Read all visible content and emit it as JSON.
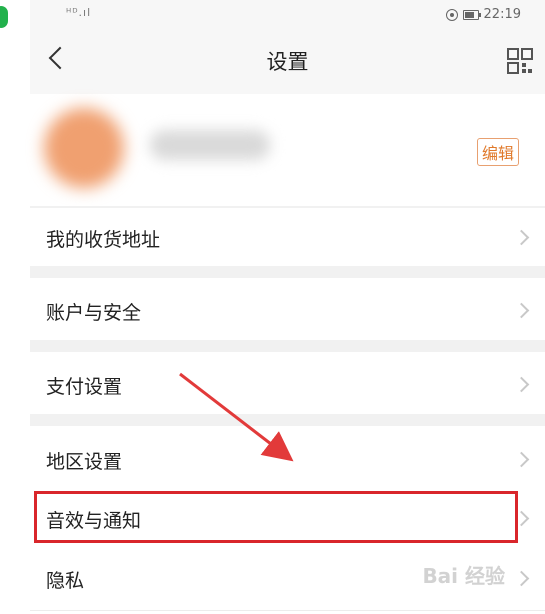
{
  "statusbar": {
    "signal": "ᴴᴰ.ıl",
    "time": "22:19"
  },
  "header": {
    "title": "设置"
  },
  "profile": {
    "edit_label": "编辑"
  },
  "menu": [
    {
      "label": "我的收货地址"
    },
    {
      "label": "账户与安全"
    },
    {
      "label": "支付设置"
    },
    {
      "label": "地区设置"
    },
    {
      "label": "音效与通知"
    },
    {
      "label": "隐私"
    }
  ],
  "watermark": "Bai 经验",
  "colors": {
    "accent": "#e07a2c",
    "highlight": "#d9262b",
    "background": "#f1f1f1"
  }
}
